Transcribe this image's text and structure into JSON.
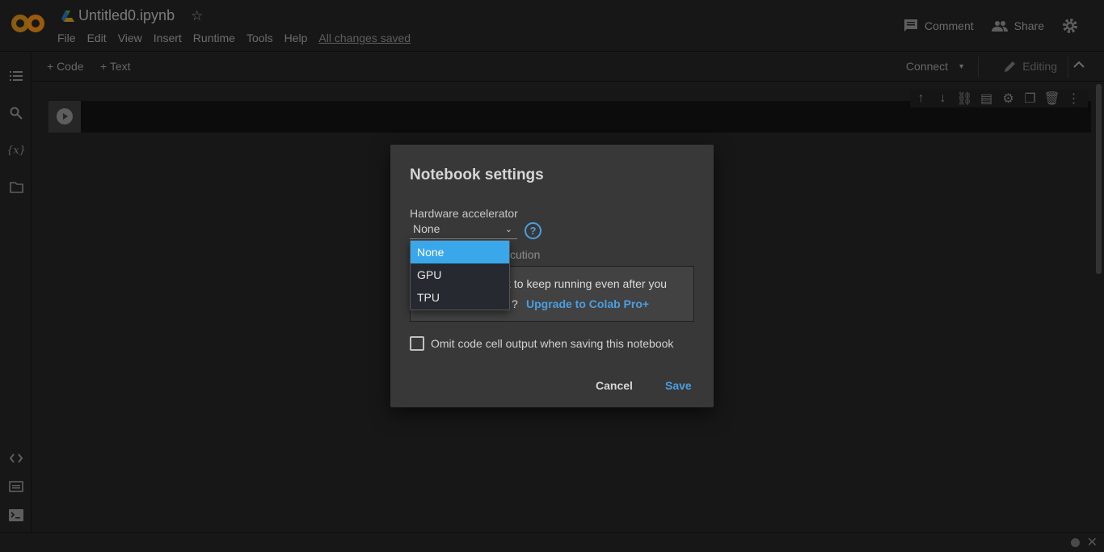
{
  "header": {
    "doc_title": "Untitled0.ipynb",
    "menu": [
      "File",
      "Edit",
      "View",
      "Insert",
      "Runtime",
      "Tools",
      "Help"
    ],
    "save_status": "All changes saved",
    "comment_label": "Comment",
    "share_label": "Share"
  },
  "toolbar": {
    "add_code": "+ Code",
    "add_text": "+ Text",
    "connect": "Connect",
    "editing": "Editing"
  },
  "rail": {
    "icons": [
      "toc-icon",
      "search-icon",
      "variables-icon",
      "files-icon",
      "code-snippets-icon",
      "command-palette-icon",
      "terminal-icon"
    ],
    "variables_glyph": "{x}"
  },
  "dialog": {
    "title": "Notebook settings",
    "hw_label": "Hardware accelerator",
    "hw_value": "None",
    "hw_options": [
      "None",
      "GPU",
      "TPU"
    ],
    "hw_selected_index": 0,
    "help_glyph": "?",
    "background_label_visible": "cution",
    "upsell_text_visible": "k to keep running even after you",
    "upsell_q_visible": "?",
    "upsell_link": "Upgrade to Colab Pro+",
    "omit_label": "Omit code cell output when saving this notebook",
    "omit_checked": false,
    "cancel": "Cancel",
    "save": "Save"
  },
  "colors": {
    "accent_blue": "#4a9fe2",
    "selected_option": "#3aa7ea",
    "dialog_bg": "#383838",
    "page_bg": "#171717",
    "logo_orange": "#e8710a"
  }
}
